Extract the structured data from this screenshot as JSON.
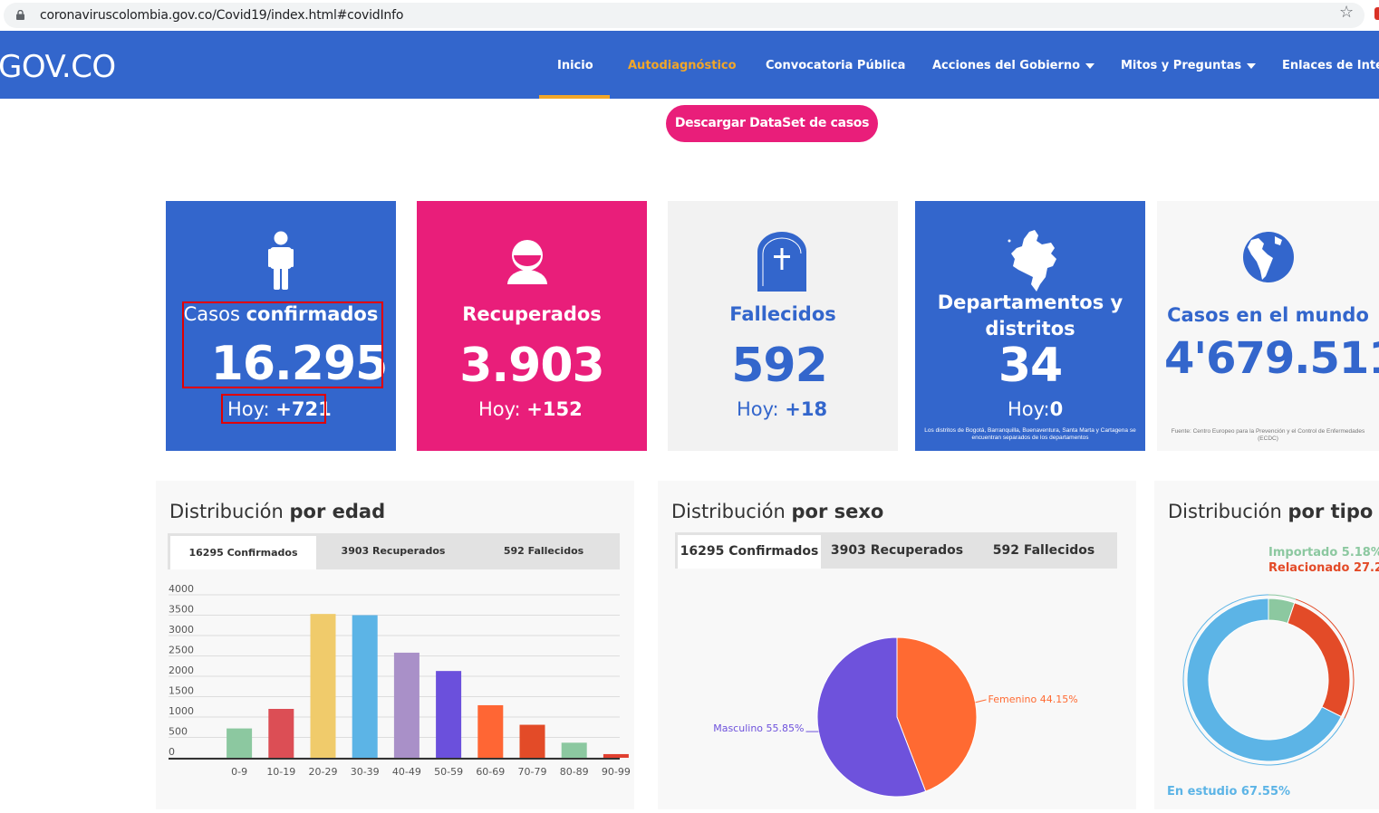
{
  "browser": {
    "url": "coronaviruscolombia.gov.co/Covid19/index.html#covidInfo"
  },
  "nav": {
    "logo": "GOV.CO",
    "items": [
      "Inicio",
      "Autodiagnóstico",
      "Convocatoria Pública",
      "Acciones del Gobierno",
      "Mitos y Preguntas",
      "Enlaces de Inte"
    ]
  },
  "download_button": "Descargar DataSet de casos",
  "cards": {
    "confirmados": {
      "title_regular": "Casos ",
      "title_bold": "confirmados",
      "value": "16.295",
      "today_label": "Hoy: ",
      "today_value": "+721"
    },
    "recuperados": {
      "title": "Recuperados",
      "value": "3.903",
      "today_label": "Hoy: ",
      "today_value": "+152"
    },
    "fallecidos": {
      "title": "Fallecidos",
      "value": "592",
      "today_label": "Hoy: ",
      "today_value": "+18"
    },
    "departamentos": {
      "title_line1": "Departamentos y",
      "title_line2": "distritos",
      "value": "34",
      "today_label": "Hoy:",
      "today_value": "0",
      "note": "Los distritos de Bogotá, Barranquilla, Buenaventura, Santa Marta y Cartagena se encuentran separados de los departamentos"
    },
    "mundo": {
      "title": "Casos en el mundo",
      "value": "4'679.511",
      "note": "Fuente: Centro Europeo para la Prevención y el Control de Enfermedades (ECDC)"
    }
  },
  "colors": {
    "blue": "#3366cc",
    "pink": "#e91e7a",
    "gray_card": "#f2f2f2",
    "orange_nav": "#f2a628"
  },
  "panels": {
    "edad": {
      "title_regular": "Distribución ",
      "title_bold": "por edad",
      "tabs": [
        "16295 Confirmados",
        "3903 Recuperados",
        "592 Fallecidos"
      ]
    },
    "sexo": {
      "title_regular": "Distribución ",
      "title_bold": "por sexo",
      "tabs": [
        "16295 Confirmados",
        "3903 Recuperados",
        "592 Fallecidos"
      ]
    },
    "tipo": {
      "title_regular": "Distribución ",
      "title_bold": "por tipo"
    }
  },
  "chart_data": [
    {
      "type": "bar",
      "categories": [
        "0-9",
        "10-19",
        "20-29",
        "30-39",
        "40-49",
        "50-59",
        "60-69",
        "70-79",
        "80-89",
        "90-99"
      ],
      "values": [
        720,
        1200,
        3530,
        3500,
        2580,
        2130,
        1290,
        810,
        370,
        90
      ],
      "colors": [
        "#8cc8a0",
        "#dc4e55",
        "#f0cb6b",
        "#5cb4e6",
        "#a990c8",
        "#6b50dc",
        "#ff6634",
        "#e34b28",
        "#8cc8a0",
        "#e04030"
      ],
      "yticks": [
        "4000",
        "3500",
        "3000",
        "2500",
        "2000",
        "1500",
        "1000",
        "500",
        "0"
      ],
      "ylim": [
        0,
        4000
      ]
    },
    {
      "type": "pie",
      "slices": [
        {
          "label": "Femenino 44.15%",
          "value": 44.15,
          "color": "#ff6a32"
        },
        {
          "label": "Masculino 55.85%",
          "value": 55.85,
          "color": "#6e52dc"
        }
      ]
    },
    {
      "type": "pie",
      "donut": true,
      "slices": [
        {
          "label": "Importado 5.18%",
          "value": 5.18,
          "color": "#8cc8a0"
        },
        {
          "label": "Relacionado 27.2",
          "value": 27.27,
          "color": "#e34b28"
        },
        {
          "label": "En estudio 67.55%",
          "value": 67.55,
          "color": "#5cb4e6"
        }
      ]
    }
  ]
}
